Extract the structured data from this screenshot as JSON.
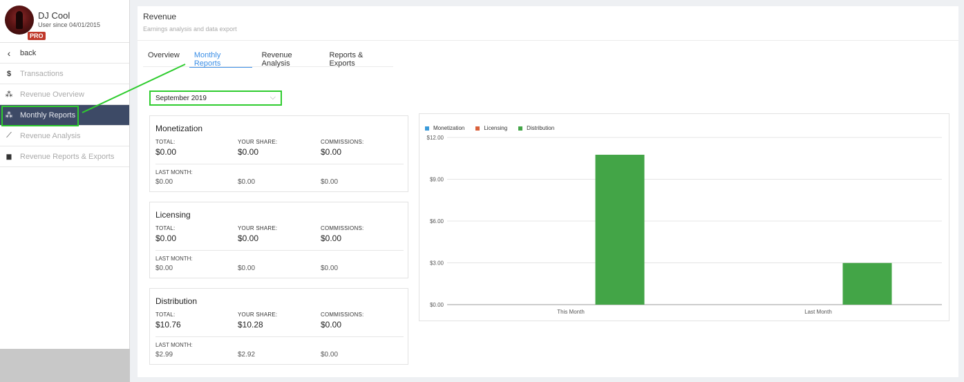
{
  "profile": {
    "name": "DJ Cool",
    "since": "User since 04/01/2015",
    "badge": "PRO"
  },
  "sidebar": {
    "items": [
      {
        "label": "back",
        "icon": "chevron-left-icon",
        "glyph": "‹"
      },
      {
        "label": "Transactions",
        "icon": "dollar-icon",
        "glyph": "$"
      },
      {
        "label": "Revenue Overview",
        "icon": "network-icon",
        "glyph": "⁂"
      },
      {
        "label": "Monthly Reports",
        "icon": "network-icon",
        "glyph": "⁂"
      },
      {
        "label": "Revenue Analysis",
        "icon": "line-chart-icon",
        "glyph": "⟋"
      },
      {
        "label": "Revenue Reports & Exports",
        "icon": "document-icon",
        "glyph": "▆"
      }
    ]
  },
  "header": {
    "title": "Revenue",
    "subtitle": "Earnings analysis and data export"
  },
  "tabs": [
    {
      "label": "Overview"
    },
    {
      "label": "Monthly Reports"
    },
    {
      "label": "Revenue Analysis"
    },
    {
      "label": "Reports & Exports"
    }
  ],
  "month_select": {
    "value": "September 2019"
  },
  "cards": [
    {
      "title": "Monetization",
      "total_label": "TOTAL:",
      "total": "$0.00",
      "share_label": "YOUR SHARE:",
      "share": "$0.00",
      "comm_label": "COMMISSIONS:",
      "comm": "$0.00",
      "last_label": "LAST MONTH:",
      "last_total": "$0.00",
      "last_share": "$0.00",
      "last_comm": "$0.00"
    },
    {
      "title": "Licensing",
      "total_label": "TOTAL:",
      "total": "$0.00",
      "share_label": "YOUR SHARE:",
      "share": "$0.00",
      "comm_label": "COMMISSIONS:",
      "comm": "$0.00",
      "last_label": "LAST MONTH:",
      "last_total": "$0.00",
      "last_share": "$0.00",
      "last_comm": "$0.00"
    },
    {
      "title": "Distribution",
      "total_label": "TOTAL:",
      "total": "$10.76",
      "share_label": "YOUR SHARE:",
      "share": "$10.28",
      "comm_label": "COMMISSIONS:",
      "comm": "$0.00",
      "last_label": "LAST MONTH:",
      "last_total": "$2.99",
      "last_share": "$2.92",
      "last_comm": "$0.00"
    }
  ],
  "chart_data": {
    "type": "bar",
    "categories": [
      "This Month",
      "Last Month"
    ],
    "series": [
      {
        "name": "Monetization",
        "color": "#3a9ad9",
        "values": [
          0,
          0
        ]
      },
      {
        "name": "Licensing",
        "color": "#d9603a",
        "values": [
          0,
          0
        ]
      },
      {
        "name": "Distribution",
        "color": "#43a547",
        "values": [
          10.76,
          2.99
        ]
      }
    ],
    "ylim": [
      0,
      12
    ],
    "yticks": [
      "$0.00",
      "$3.00",
      "$6.00",
      "$9.00",
      "$12.00"
    ],
    "ytick_values": [
      0,
      3,
      6,
      9,
      12
    ],
    "legend": "top-left",
    "grid": true
  }
}
